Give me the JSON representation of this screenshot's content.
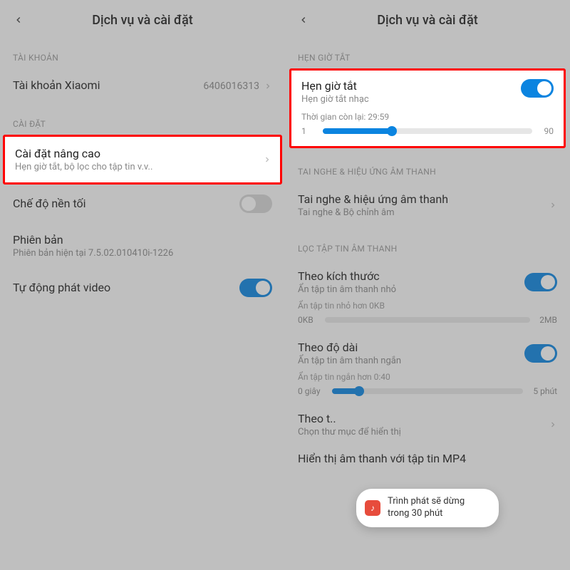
{
  "left": {
    "title": "Dịch vụ và cài đặt",
    "sections": {
      "account": "TÀI KHOẢN",
      "settings": "CÀI ĐẶT"
    },
    "account_row": {
      "label": "Tài khoản Xiaomi",
      "value": "6406016313"
    },
    "advanced": {
      "title": "Cài đặt nâng cao",
      "sub": "Hẹn giờ tắt, bộ lọc cho tập tin v.v.."
    },
    "dark_mode": {
      "title": "Chế độ nền tối"
    },
    "version": {
      "title": "Phiên bản",
      "sub": "Phiên bản hiện tại 7.5.02.010410i-1226"
    },
    "autoplay": {
      "title": "Tự động phát video"
    }
  },
  "right": {
    "title": "Dịch vụ và cài đặt",
    "sections": {
      "timer": "HẸN GIỜ TẮT",
      "headphones": "TAI NGHE & HIỆU ỨNG ÂM THANH",
      "filter": "LỌC TẬP TIN ÂM THANH"
    },
    "timer": {
      "title": "Hẹn giờ tắt",
      "sub": "Hẹn giờ tắt nhạc",
      "remain": "Thời gian còn lại: 29:59",
      "min": "1",
      "max": "90"
    },
    "headphones": {
      "title": "Tai nghe & hiệu ứng âm thanh",
      "sub": "Tai nghe & Bộ chỉnh âm"
    },
    "by_size": {
      "title": "Theo kích thước",
      "sub": "Ẩn tập tin âm thanh nhỏ",
      "limit": "Ẩn tập tin nhỏ hơn 0KB",
      "min": "0KB",
      "max": "2MB"
    },
    "by_length": {
      "title": "Theo độ dài",
      "sub": "Ẩn tập tin âm thanh ngắn",
      "limit": "Ẩn tập tin ngắn hơn 0:40",
      "min": "0 giây",
      "max": "5 phút"
    },
    "by_folder": {
      "title": "Theo t..",
      "sub": "Chọn thư mục để hiển thị"
    },
    "mp4": {
      "title": "Hiển thị âm thanh với tập tin MP4"
    },
    "toast": "Trình phát sẽ dừng trong 30 phút"
  },
  "slider_positions": {
    "timer_pct": 33,
    "size_pct": 0,
    "length_pct": 14
  }
}
